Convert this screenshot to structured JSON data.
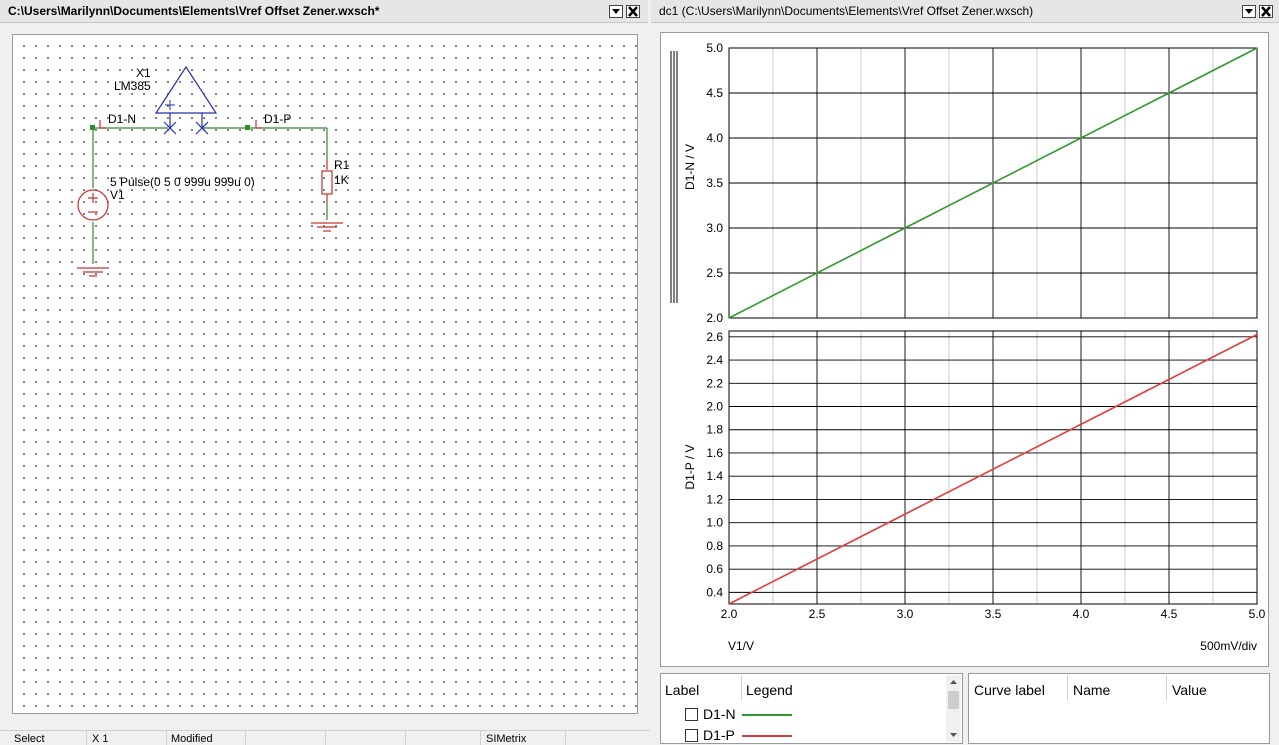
{
  "schematic": {
    "title": "C:\\Users\\Marilynn\\Documents\\Elements\\Vref Offset Zener.wxsch*",
    "components": {
      "x1_ref": "X1",
      "x1_model": "LM385",
      "r1_ref": "R1",
      "r1_value": "1K",
      "v1_ref": "V1",
      "v1_value": "5 Pulse(0 5 0 999u 999u 0)"
    },
    "probes": {
      "n": "D1-N",
      "p": "D1-P"
    }
  },
  "status": [
    "Select",
    "X 1",
    "Modified",
    "SIMetrix"
  ],
  "graph": {
    "title": "dc1 (C:\\Users\\Marilynn\\Documents\\Elements\\Vref Offset Zener.wxsch)",
    "x_axis_label": "V1/V",
    "x_div_label": "500mV/div",
    "x_tick_labels": [
      "2.0",
      "2.5",
      "3.0",
      "3.5",
      "4.0",
      "4.5",
      "5.0"
    ],
    "top": {
      "ylabel": "D1-N / V",
      "y_tick_labels": [
        "5.0",
        "4.5",
        "4.0",
        "3.5",
        "3.0",
        "2.5",
        "2.0"
      ]
    },
    "bottom": {
      "ylabel": "D1-P / V",
      "y_tick_labels": [
        "2.6",
        "2.4",
        "2.2",
        "2.0",
        "1.8",
        "1.6",
        "1.4",
        "1.2",
        "1.0",
        "0.8",
        "0.6",
        "0.4"
      ]
    }
  },
  "legend_panel": {
    "headers": [
      "Label",
      "Legend"
    ],
    "rows": [
      {
        "label": "D1-N",
        "color": "#2e9a2e"
      },
      {
        "label": "D1-P",
        "color": "#e33b3b"
      }
    ]
  },
  "cursor_panel": {
    "headers": [
      "Curve label",
      "Name",
      "Value"
    ]
  },
  "chart_data": {
    "type": "line",
    "xlabel": "V1/V",
    "xlim": [
      2.0,
      5.0
    ],
    "plots": [
      {
        "ylabel": "D1-N / V",
        "ylim": [
          2.0,
          5.0
        ],
        "series": [
          {
            "name": "D1-N",
            "color": "#2e9a2e",
            "x": [
              2.0,
              5.0
            ],
            "y": [
              2.0,
              5.0
            ]
          }
        ]
      },
      {
        "ylabel": "D1-P / V",
        "ylim": [
          0.3,
          2.65
        ],
        "series": [
          {
            "name": "D1-P",
            "color": "#e33b3b",
            "x": [
              2.0,
              5.0
            ],
            "y": [
              0.3,
              2.62
            ]
          }
        ]
      }
    ],
    "grid": true
  }
}
